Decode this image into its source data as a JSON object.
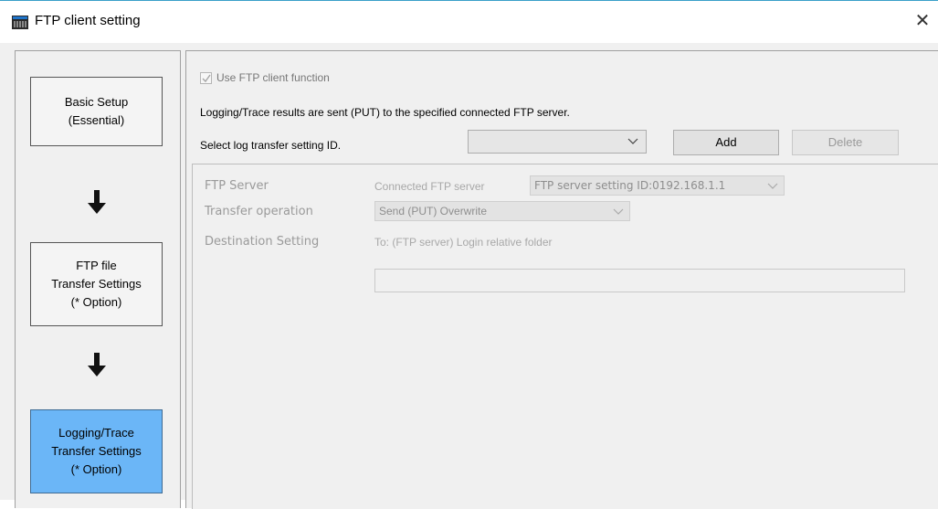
{
  "window": {
    "title": "FTP client setting",
    "close_glyph": "✕"
  },
  "steps": [
    {
      "line1": "Basic Setup",
      "line2": "(Essential)",
      "line3": ""
    },
    {
      "line1": "FTP file",
      "line2": "Transfer Settings",
      "line3": "(* Option)"
    },
    {
      "line1": "Logging/Trace",
      "line2": "Transfer Settings",
      "line3": "(* Option)"
    }
  ],
  "main": {
    "use_ftp_label": "Use FTP client function",
    "use_ftp_checked": true,
    "description": "Logging/Trace results are sent (PUT) to the specified connected FTP server.",
    "select_label": "Select log transfer setting ID.",
    "select_value": "",
    "add_label": "Add",
    "delete_label": "Delete"
  },
  "settings": {
    "ftp_server_label": "FTP Server",
    "connected_label": "Connected FTP server",
    "server_value": "FTP server setting ID:0192.168.1.1",
    "transfer_label": "Transfer operation",
    "transfer_value": "Send (PUT) Overwrite",
    "destination_label": "Destination Setting",
    "destination_sub": "To: (FTP server) Login relative folder",
    "destination_value": ""
  },
  "colors": {
    "active_step": "#6bb6f7",
    "panel": "#f0f0f0",
    "titlebar_accent": "#3aa0c8"
  },
  "icons": [
    "app-icon",
    "close-icon",
    "down-arrow-icon",
    "chevron-down-icon",
    "check-icon"
  ]
}
